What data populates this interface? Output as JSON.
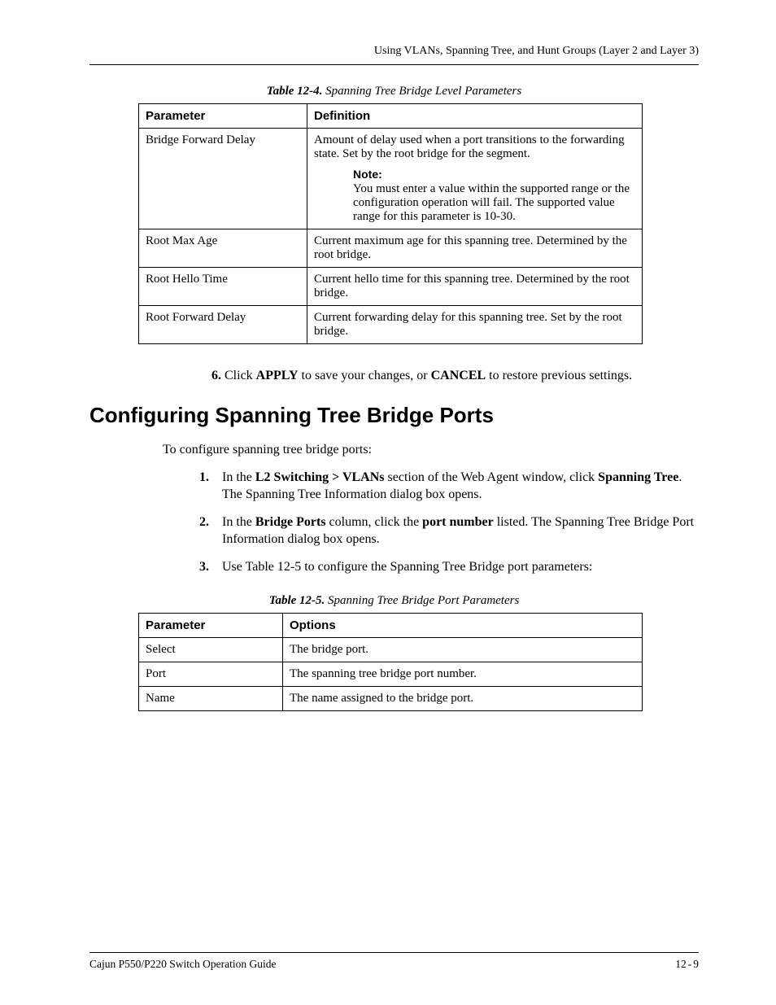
{
  "header": {
    "running_title": "Using VLANs, Spanning Tree, and Hunt Groups (Layer 2 and Layer 3)"
  },
  "table1": {
    "caption_label": "Table 12-4.",
    "caption_title": "Spanning Tree Bridge Level Parameters",
    "col1": "Parameter",
    "col2": "Definition",
    "rows": [
      {
        "param": "Bridge Forward Delay",
        "def_main": "Amount of delay used when a port transitions to the forwarding state. Set by the root bridge for the segment.",
        "note_label": "Note:",
        "note_text": "You must enter a value within the supported range or the configuration operation will fail. The supported value range for this parameter is 10-30."
      },
      {
        "param": "Root Max Age",
        "def_main": "Current maximum age for this spanning tree. Determined by the root bridge."
      },
      {
        "param": "Root Hello Time",
        "def_main": "Current hello time for this spanning tree. Determined by the root bridge."
      },
      {
        "param": "Root Forward Delay",
        "def_main": "Current forwarding delay for this spanning tree. Set by the root bridge."
      }
    ]
  },
  "step6": {
    "num": "6.",
    "pre": "Click ",
    "apply": "APPLY",
    "mid": " to save your changes, or ",
    "cancel": "CANCEL",
    "post": " to restore previous settings."
  },
  "section_title": "Configuring Spanning Tree Bridge Ports",
  "intro": "To configure spanning tree bridge ports:",
  "steps": {
    "s1": {
      "num": "1.",
      "a": "In the ",
      "b": "L2 Switching > VLANs",
      "c": " section of the Web Agent window, click ",
      "d": "Spanning Tree",
      "e": ". The Spanning Tree Information dialog box opens."
    },
    "s2": {
      "num": "2.",
      "a": "In the ",
      "b": "Bridge Ports",
      "c": " column, click the ",
      "d": "port number",
      "e": " listed. The Spanning Tree Bridge Port Information dialog box opens."
    },
    "s3": {
      "num": "3.",
      "text": "Use Table 12-5 to configure the Spanning Tree Bridge port parameters:"
    }
  },
  "table2": {
    "caption_label": "Table 12-5.",
    "caption_title": "Spanning Tree Bridge Port Parameters",
    "col1": "Parameter",
    "col2": "Options",
    "rows": [
      {
        "param": "Select",
        "opt": "The bridge port."
      },
      {
        "param": "Port",
        "opt": "The spanning tree bridge port number."
      },
      {
        "param": "Name",
        "opt": "The name assigned to the bridge port."
      }
    ]
  },
  "footer": {
    "left": "Cajun P550/P220 Switch Operation Guide",
    "right_chapter": "12",
    "right_dash": "-",
    "right_page": "9"
  }
}
